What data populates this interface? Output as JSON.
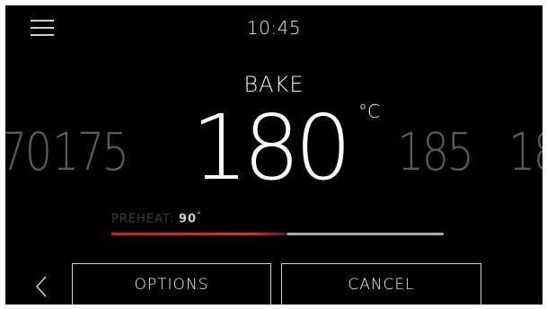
{
  "header": {
    "time": "10:45",
    "menu_icon": "hamburger-menu-icon"
  },
  "mode": {
    "name": "BAKE"
  },
  "temperature": {
    "unit": "°C",
    "selected": "180",
    "left_values": [
      "70",
      "175"
    ],
    "right_values": [
      "185",
      "18"
    ]
  },
  "preheat": {
    "label": "PREHEAT:",
    "value": "90",
    "degree": "°",
    "progress": 0.53
  },
  "footer": {
    "back_icon": "chevron-left-icon",
    "options_label": "OPTIONS",
    "cancel_label": "CANCEL"
  },
  "colors": {
    "background": "#000000",
    "accent": "#e02a33"
  }
}
